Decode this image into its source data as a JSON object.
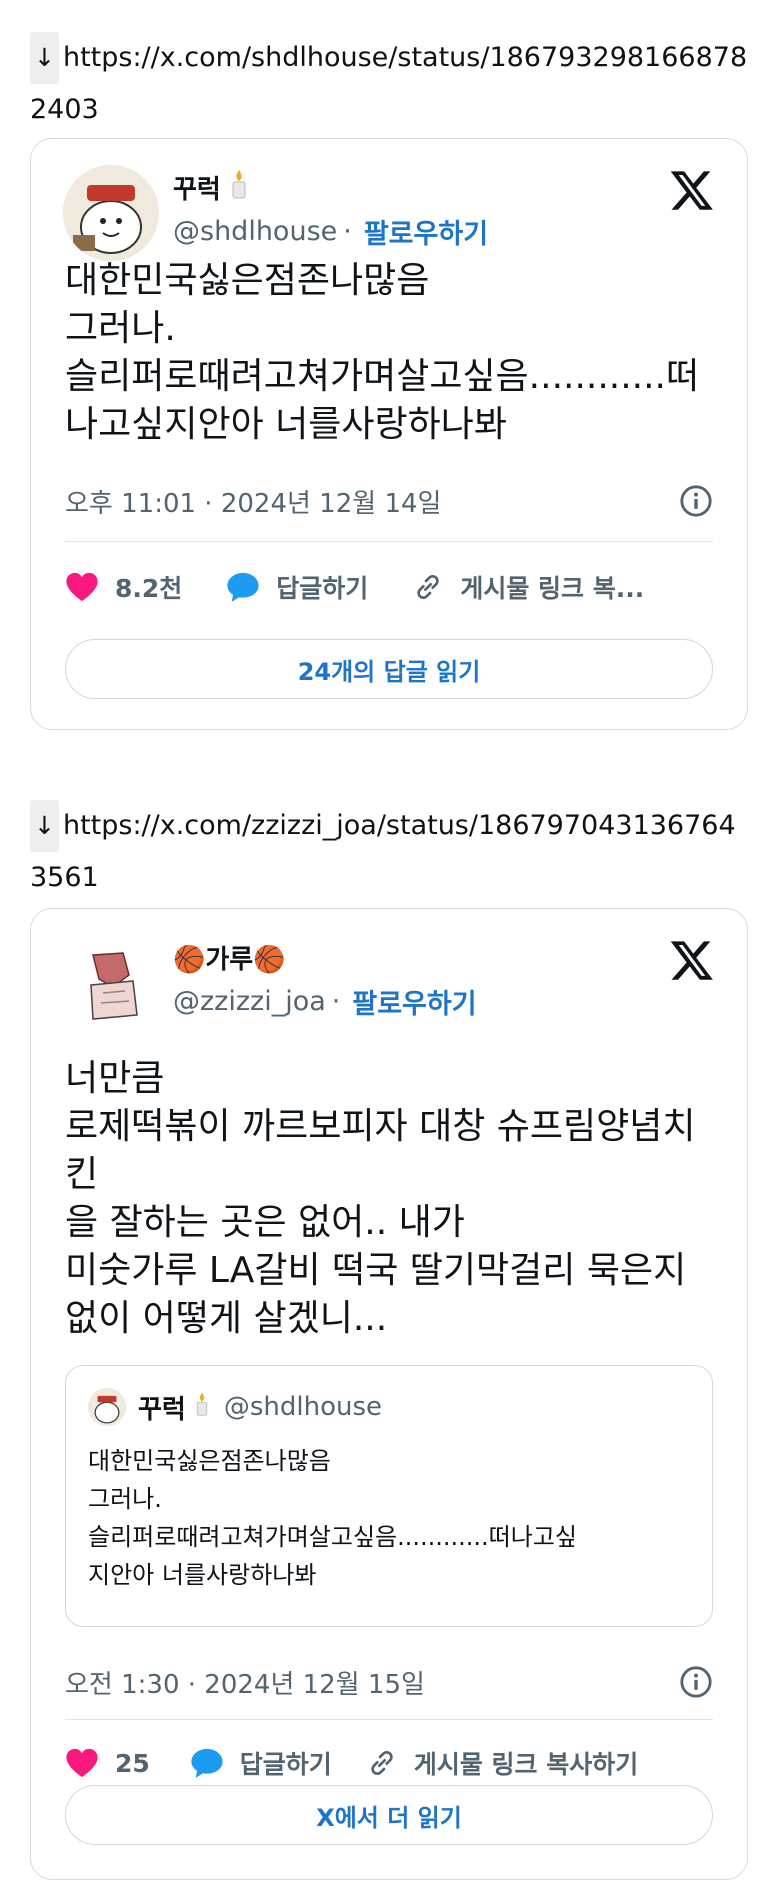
{
  "posts": [
    {
      "link_arrow": "↓",
      "url": "https://x.com/shdlhouse/status/1867932981668782403",
      "author_name": "꾸럭",
      "author_emoji": "🕯️",
      "handle": "@shdlhouse",
      "separator": "·",
      "follow_label": "팔로우하기",
      "body_lines": [
        "대한민국싫은점존나많음",
        "그러나.",
        "슬리퍼로때려고쳐가며살고싶음............떠",
        "나고싶지안아 너를사랑하나봐"
      ],
      "timestamp": "오후 11:01 · 2024년 12월 14일",
      "like_count": "8.2천",
      "reply_label": "답글하기",
      "copy_link_label": "게시물 링크 복...",
      "read_button_label": "24개의 답글 읽기"
    },
    {
      "link_arrow": "↓",
      "url": "https://x.com/zzizzi_joa/status/1867970431367643561",
      "author_name": "🏀가루🏀",
      "handle": "@zzizzi_joa",
      "separator": "·",
      "follow_label": "팔로우하기",
      "body_lines": [
        "너만큼",
        "로제떡볶이 까르보피자 대창 슈프림양념치",
        "킨",
        "을 잘하는 곳은 없어.. 내가",
        "미숫가루 LA갈비 떡국 딸기막걸리 묵은지",
        "없이 어떻게 살겠니..."
      ],
      "quote": {
        "author_name": "꾸럭",
        "author_emoji": "🕯️",
        "handle": "@shdlhouse",
        "body_lines": [
          "대한민국싫은점존나많음",
          "그러나.",
          "슬리퍼로때려고쳐가며살고싶음............떠나고싶",
          "지안아 너를사랑하나봐"
        ]
      },
      "timestamp": "오전 1:30 · 2024년 12월 15일",
      "like_count": "25",
      "reply_label": "답글하기",
      "copy_link_label": "게시물 링크 복사하기",
      "read_button_label": "X에서 더 읽기"
    }
  ],
  "colors": {
    "accent_blue": "#1d74c9",
    "heart_pink": "#f91880",
    "muted_gray": "#536471",
    "border": "#cfd9de"
  },
  "icons": [
    "x-logo-icon",
    "heart-icon",
    "reply-bubble-icon",
    "link-icon",
    "info-icon",
    "candle-icon",
    "basketball-icon"
  ]
}
